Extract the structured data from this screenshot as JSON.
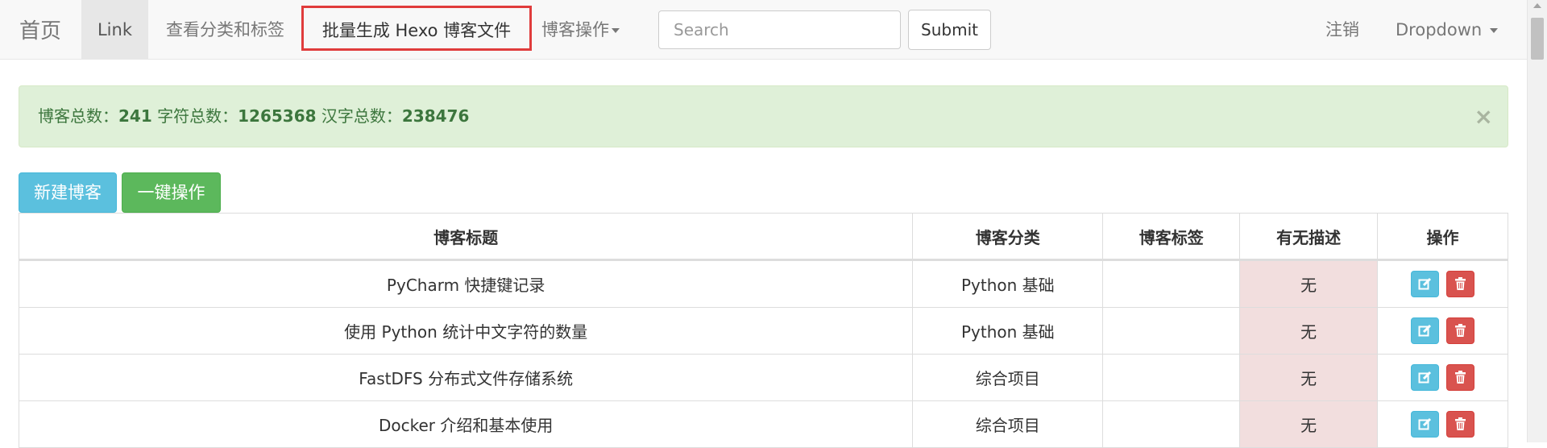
{
  "navbar": {
    "brand": "首页",
    "link": "Link",
    "tags": "查看分类和标签",
    "generate": "批量生成 Hexo 博客文件",
    "operations": "博客操作",
    "search_placeholder": "Search",
    "submit": "Submit",
    "logout": "注销",
    "dropdown": "Dropdown"
  },
  "alert": {
    "total_label": "博客总数：",
    "total_value": "241",
    "chars_label": " 字符总数：",
    "chars_value": "1265368",
    "hanzi_label": " 汉字总数：",
    "hanzi_value": "238476",
    "close": "×"
  },
  "buttons": {
    "new_blog": "新建博客",
    "batch_ops": "一键操作"
  },
  "table": {
    "headers": [
      "博客标题",
      "博客分类",
      "博客标签",
      "有无描述",
      "操作"
    ],
    "rows": [
      {
        "title": "PyCharm 快捷键记录",
        "category": "Python 基础",
        "tags": "",
        "desc": "无"
      },
      {
        "title": "使用 Python 统计中文字符的数量",
        "category": "Python 基础",
        "tags": "",
        "desc": "无"
      },
      {
        "title": "FastDFS 分布式文件存储系统",
        "category": "综合项目",
        "tags": "",
        "desc": "无"
      },
      {
        "title": "Docker 介绍和基本使用",
        "category": "综合项目",
        "tags": "",
        "desc": "无"
      }
    ]
  }
}
